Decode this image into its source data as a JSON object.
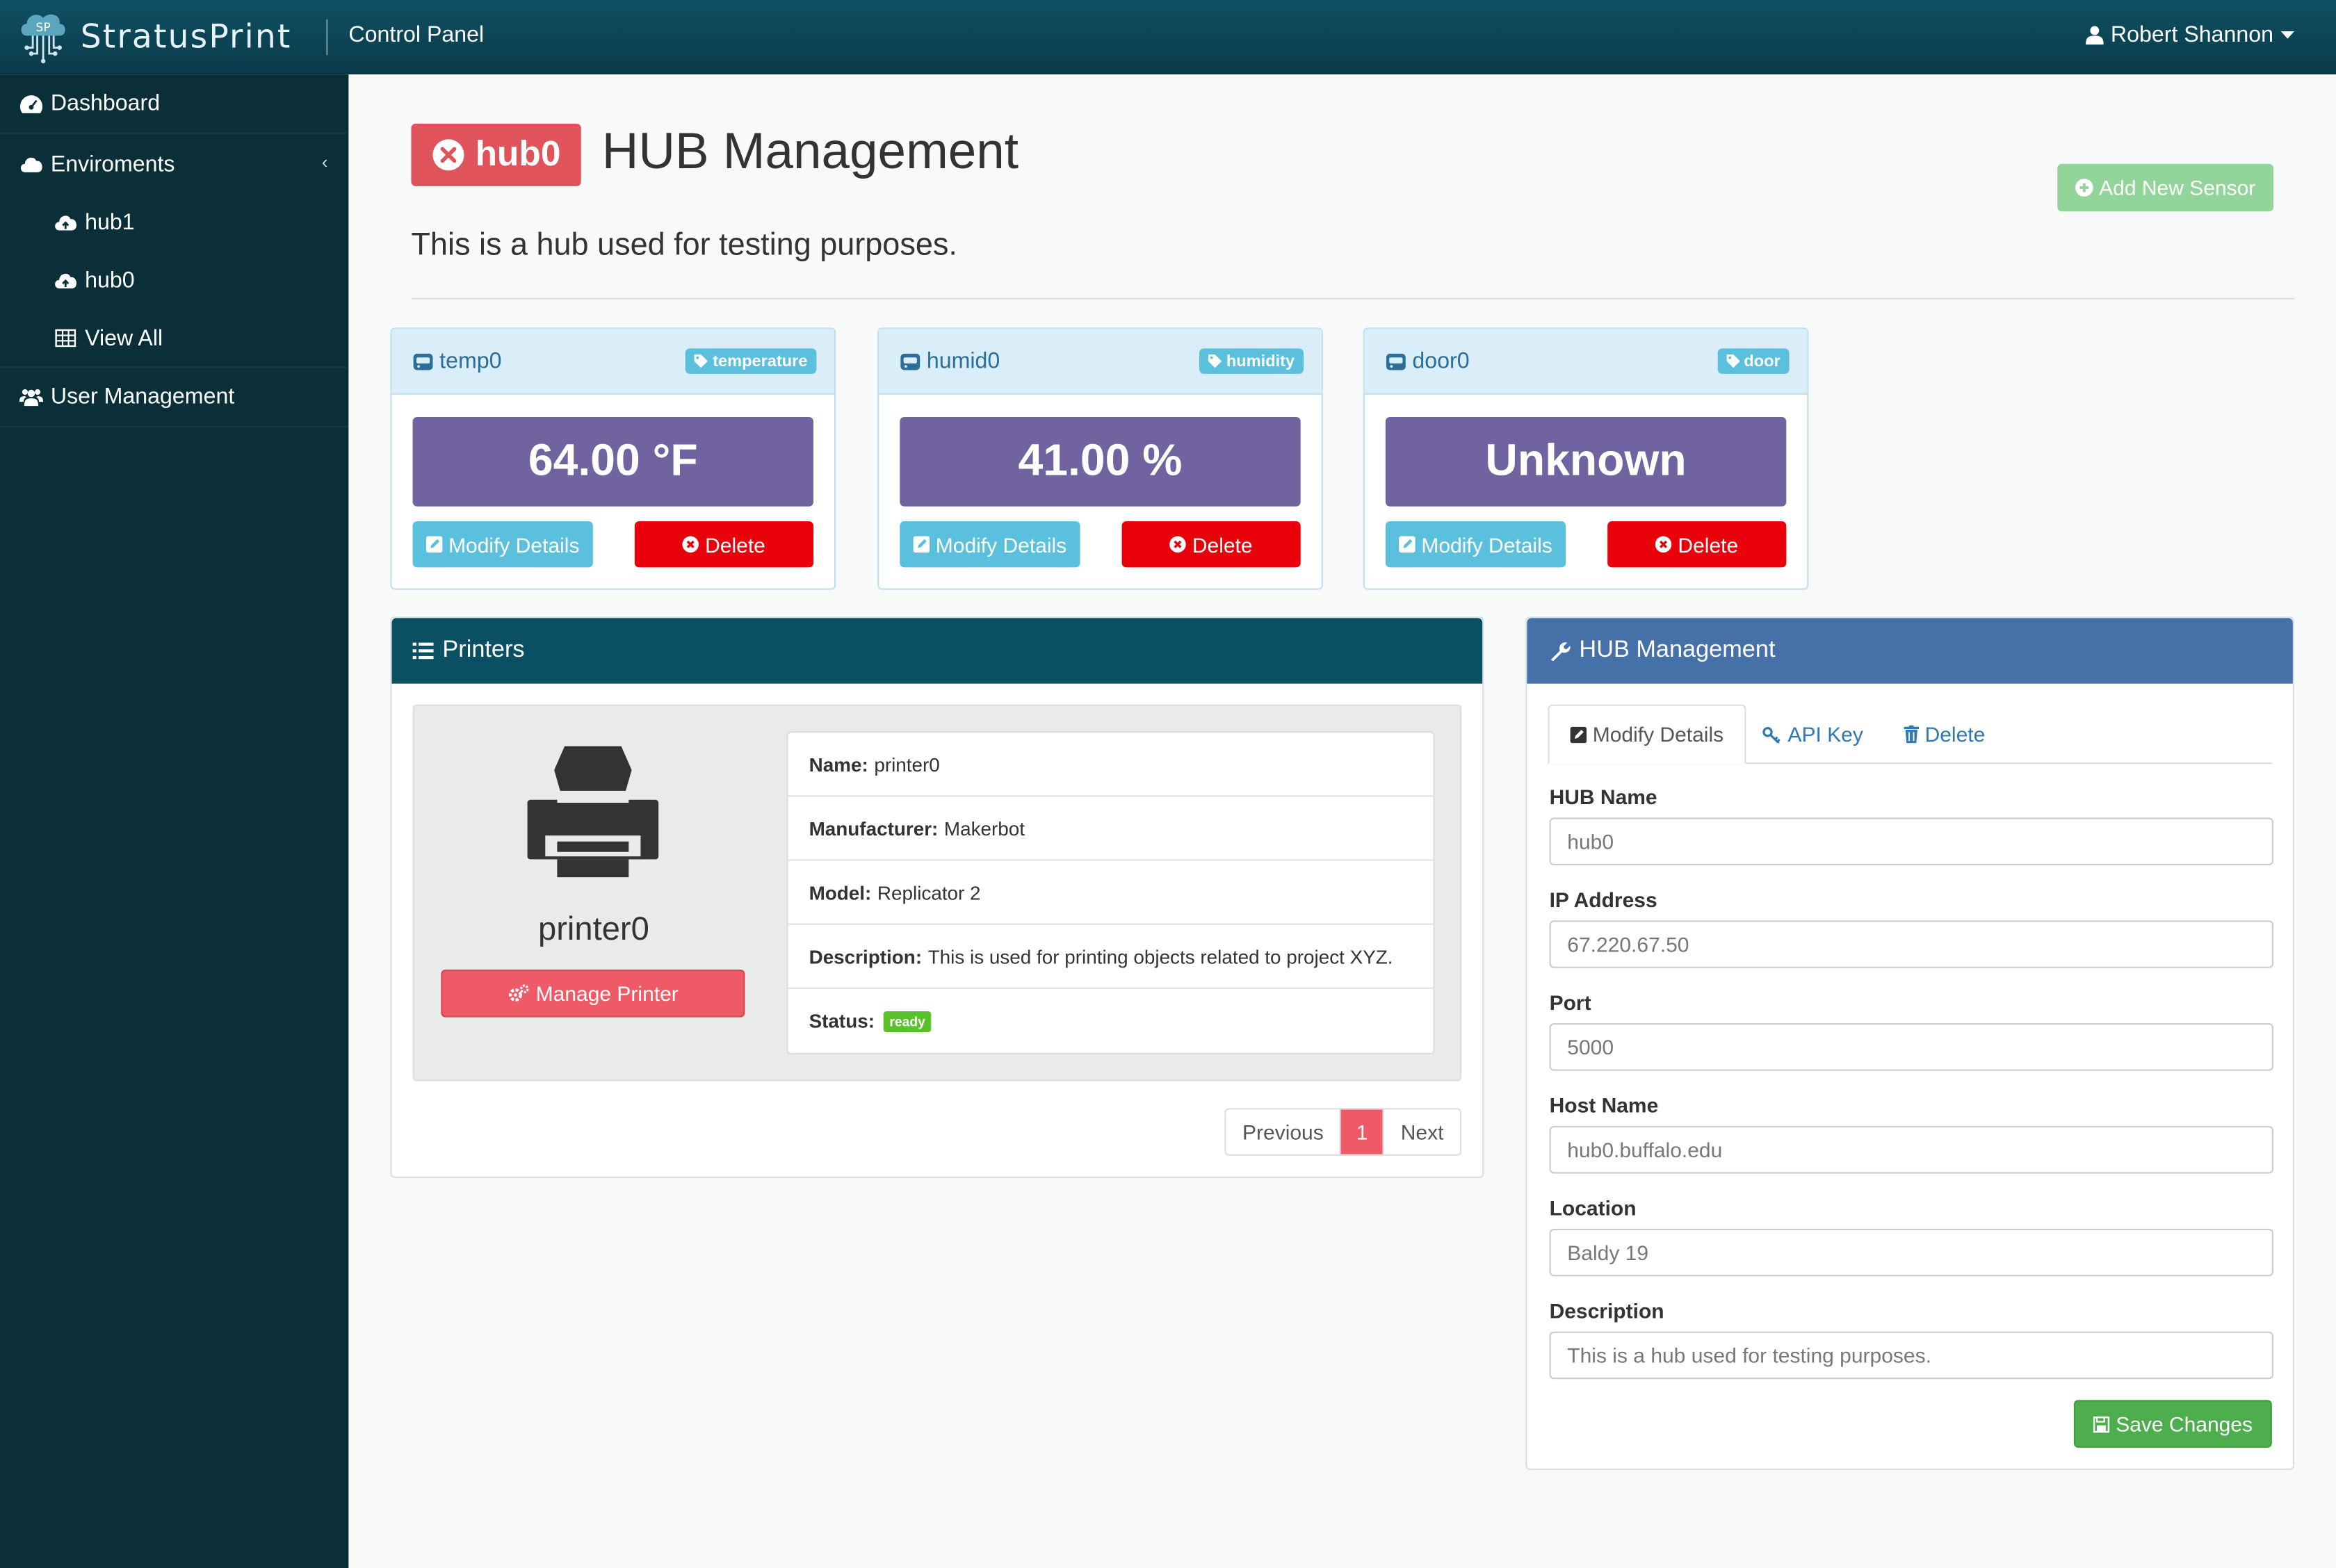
{
  "app": {
    "brand": "StratusPrint",
    "logo_text": "SP",
    "panel_title": "Control Panel",
    "user": "Robert Shannon"
  },
  "sidebar": {
    "items": [
      {
        "label": "Dashboard",
        "icon": "dashboard-icon"
      },
      {
        "label": "Enviroments",
        "icon": "cloud-icon"
      },
      {
        "label": "hub1",
        "icon": "cloud-upload-icon"
      },
      {
        "label": "hub0",
        "icon": "cloud-upload-icon"
      },
      {
        "label": "View All",
        "icon": "table-icon"
      },
      {
        "label": "User Management",
        "icon": "users-icon"
      }
    ]
  },
  "header": {
    "hub_badge": "hub0",
    "title": "HUB Management",
    "description": "This is a hub used for testing purposes.",
    "add_sensor_label": "Add New Sensor"
  },
  "sensors": [
    {
      "name": "temp0",
      "tag": "temperature",
      "value": "64.00 °F",
      "modify_label": "Modify Details",
      "delete_label": "Delete"
    },
    {
      "name": "humid0",
      "tag": "humidity",
      "value": "41.00 %",
      "modify_label": "Modify Details",
      "delete_label": "Delete"
    },
    {
      "name": "door0",
      "tag": "door",
      "value": "Unknown",
      "modify_label": "Modify Details",
      "delete_label": "Delete"
    }
  ],
  "printers": {
    "title": "Printers",
    "printer_name": "printer0",
    "manage_label": "Manage Printer",
    "details": [
      {
        "label": "Name:",
        "value": "printer0"
      },
      {
        "label": "Manufacturer:",
        "value": "Makerbot"
      },
      {
        "label": "Model:",
        "value": "Replicator 2"
      },
      {
        "label": "Description:",
        "value": "This is used for printing objects related to project XYZ."
      }
    ],
    "status_label": "Status:",
    "status_value": "ready",
    "pagination": {
      "previous": "Previous",
      "current": "1",
      "next": "Next"
    }
  },
  "hub_management": {
    "title": "HUB Management",
    "tabs": [
      "Modify Details",
      "API Key",
      "Delete"
    ],
    "fields": [
      {
        "label": "HUB Name",
        "value": "hub0"
      },
      {
        "label": "IP Address",
        "value": "67.220.67.50"
      },
      {
        "label": "Port",
        "value": "5000"
      },
      {
        "label": "Host Name",
        "value": "hub0.buffalo.edu"
      },
      {
        "label": "Location",
        "value": "Baldy 19"
      },
      {
        "label": "Description",
        "value": "This is a hub used for testing purposes."
      }
    ],
    "save_label": "Save Changes"
  },
  "colors": {
    "topbar": "#0a3b4a",
    "sidebar": "#0a2f38",
    "hub_badge": "#e0535b",
    "sensor_value": "#7063a0",
    "info": "#5bc0de",
    "danger": "#e8000b",
    "printers_header": "#0a4f62",
    "hub_header": "#4571a8",
    "success": "#4cae4c"
  }
}
